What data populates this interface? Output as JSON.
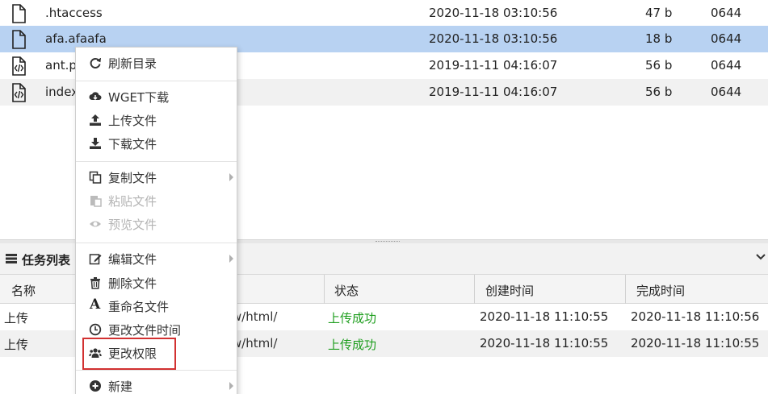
{
  "files": [
    {
      "name": ".htaccess",
      "date": "2020-11-18 03:10:56",
      "size": "47 b",
      "perm": "0644",
      "icon": "file-icon"
    },
    {
      "name": "afa.afaafa",
      "date": "2020-11-18 03:10:56",
      "size": "18 b",
      "perm": "0644",
      "icon": "file-icon"
    },
    {
      "name": "ant.php",
      "date": "2019-11-11 04:16:07",
      "size": "56 b",
      "perm": "0644",
      "icon": "code-file-icon"
    },
    {
      "name": "index.php",
      "date": "2019-11-11 04:16:07",
      "size": "56 b",
      "perm": "0644",
      "icon": "code-file-icon"
    }
  ],
  "task_panel": {
    "title": "任务列表",
    "columns": [
      "名称",
      "状态",
      "创建时间",
      "完成时间"
    ],
    "rows": [
      {
        "name": "上传",
        "path": "/var/www/html/",
        "status": "上传成功",
        "created": "2020-11-18 11:10:55",
        "finished": "2020-11-18 11:10:56"
      },
      {
        "name": "上传",
        "path": "/var/www/html/",
        "status": "上传成功",
        "created": "2020-11-18 11:10:55",
        "finished": "2020-11-18 11:10:55"
      }
    ]
  },
  "context_menu": {
    "refresh": "刷新目录",
    "wget": "WGET下载",
    "upload": "上传文件",
    "download": "下载文件",
    "copy": "复制文件",
    "paste": "粘贴文件",
    "preview": "预览文件",
    "edit": "编辑文件",
    "delete": "删除文件",
    "rename": "重命名文件",
    "change_time": "更改文件时间",
    "change_perm": "更改权限",
    "new": "新建",
    "rename_icon_glyph": "A"
  },
  "colors": {
    "selected_row": "#b8d2f2",
    "success_text": "#1e9e1e",
    "highlight_border": "#d23131"
  }
}
